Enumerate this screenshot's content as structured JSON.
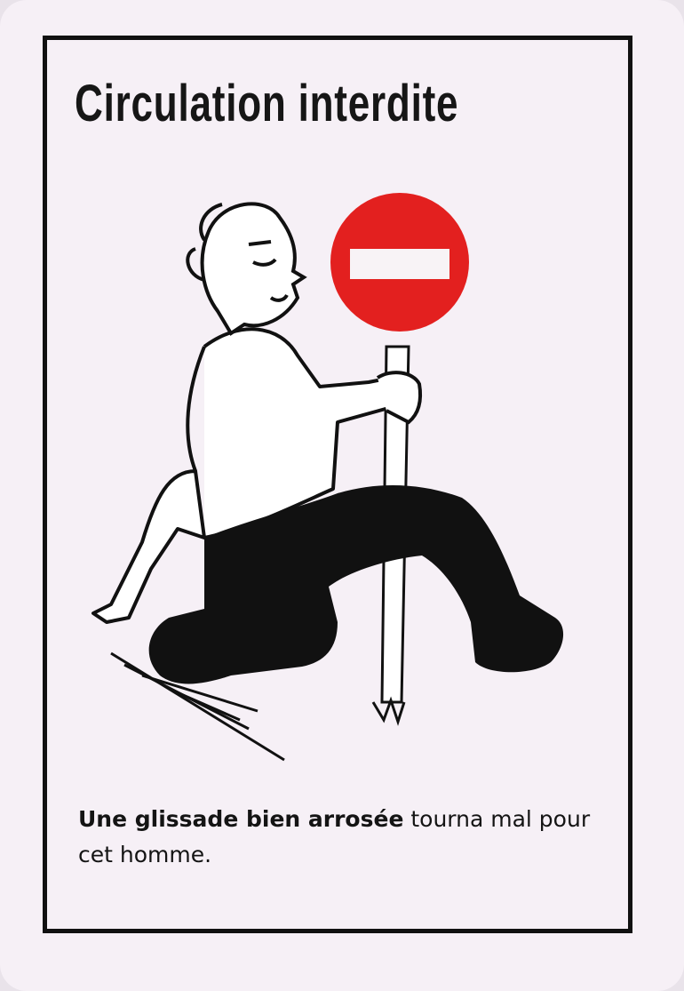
{
  "card": {
    "title": "Circulation interdite",
    "caption_bold": "Une glissade bien arrosée",
    "caption_rest": " tourna mal pour cet homme.",
    "sign_color": "#e3201f",
    "ink_color": "#111111",
    "illustration": "man-slipping-holding-no-entry-sign"
  }
}
